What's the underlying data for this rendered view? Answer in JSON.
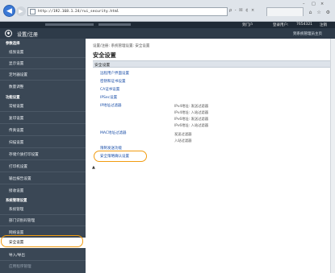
{
  "browser": {
    "url": "http://192.168.1.24/rui_security.html",
    "addr_tools": "ρ - ☒ ¢ ×",
    "window_controls": [
      "–",
      "□",
      "×"
    ],
    "toolbar_icons": "⌂ ☆ ⚙"
  },
  "header": {
    "portal_link": "到门户",
    "user_label": "登录用户:",
    "user_id": "7654321",
    "logout": "注销",
    "title": "设置/注册",
    "portal_home": "到系统管理员主页"
  },
  "sidebar": {
    "items": [
      {
        "label": "参数选择",
        "type": "heading"
      },
      {
        "label": "纸张设置",
        "type": "item"
      },
      {
        "label": "显示设置",
        "type": "item"
      },
      {
        "label": "定时器设置",
        "type": "item"
      },
      {
        "label": "数量调整",
        "type": "item"
      },
      {
        "label": "功能设置",
        "type": "heading"
      },
      {
        "label": "常规设置",
        "type": "item"
      },
      {
        "label": "复印设置",
        "type": "item"
      },
      {
        "label": "传真设置",
        "type": "item"
      },
      {
        "label": "扫描设置",
        "type": "item"
      },
      {
        "label": "存储介质打印设置",
        "type": "item"
      },
      {
        "label": "打印机设置",
        "type": "item"
      },
      {
        "label": "输出报告设置",
        "type": "item"
      },
      {
        "label": "接收设置",
        "type": "item"
      },
      {
        "label": "系统管理设置",
        "type": "heading"
      },
      {
        "label": "系统管理",
        "type": "item"
      },
      {
        "label": "部门识别码管理",
        "type": "item"
      },
      {
        "label": "网络设置",
        "type": "item"
      },
      {
        "label": "安全设置",
        "type": "active"
      },
      {
        "label": "导入/导出",
        "type": "item"
      },
      {
        "label": "应用程序管理",
        "type": "dim"
      }
    ]
  },
  "main": {
    "breadcrumb": "设置/注册: 系统管理设置: 安全设置",
    "page_title": "安全设置",
    "section_title": "安全设置",
    "links": [
      "远程用户界面设置",
      "密钥和证书设置",
      "CA证书设置",
      "IPSec设置",
      "IP地址过滤器",
      "MAC地址过滤器",
      "限制发送功能",
      "安全策略确认设置"
    ],
    "ip_filter_values": [
      "IPv4地址: 发送过滤器",
      "IPv4地址: 入站过滤器",
      "IPv6地址: 发送过滤器",
      "IPv6地址: 入站过滤器"
    ],
    "mac_filter_values": [
      "发送过滤器",
      "入站过滤器"
    ],
    "top_mark": "▲"
  },
  "colors": {
    "sidebar_bg": "#3a4755",
    "header_dark": "#1f2a36",
    "header_bar": "#2e3b49",
    "highlight": "#f29c11",
    "link": "#1b4fa8"
  }
}
